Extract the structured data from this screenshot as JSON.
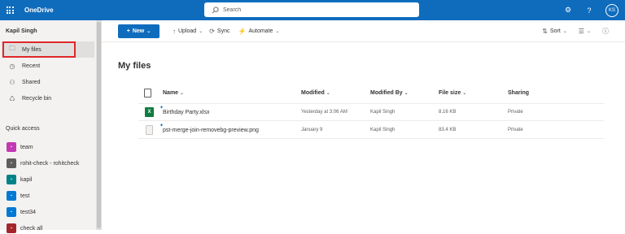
{
  "app": {
    "title": "OneDrive"
  },
  "search": {
    "placeholder": "Search"
  },
  "header": {
    "avatar_initials": "KS"
  },
  "sidebar": {
    "user_name": "Kapil Singh",
    "items": [
      {
        "label": "My files",
        "icon": "folder-icon"
      },
      {
        "label": "Recent",
        "icon": "clock-icon"
      },
      {
        "label": "Shared",
        "icon": "people-icon"
      },
      {
        "label": "Recycle bin",
        "icon": "recycle-bin-icon"
      }
    ],
    "quick_access_title": "Quick access",
    "quick_access": [
      {
        "label": "team",
        "color": "#c239b3"
      },
      {
        "label": "rohit-check - rohitcheck",
        "color": "#605e5c"
      },
      {
        "label": "kapil",
        "color": "#038387"
      },
      {
        "label": "test",
        "color": "#0078d4"
      },
      {
        "label": "test34",
        "color": "#0078d4"
      },
      {
        "label": "check all",
        "color": "#a4262c"
      }
    ]
  },
  "commands": {
    "new": "New",
    "upload": "Upload",
    "sync": "Sync",
    "automate": "Automate",
    "sort": "Sort"
  },
  "main": {
    "title": "My files",
    "columns": [
      "Name",
      "Modified",
      "Modified By",
      "File size",
      "Sharing"
    ],
    "rows": [
      {
        "name": "Birthday Party.xlsx",
        "modified": "Yesterday at 3:06 AM",
        "modified_by": "Kapil Singh",
        "size": "8.16 KB",
        "sharing": "Private"
      },
      {
        "name": "pst-merge-join-removebg-preview.png",
        "modified": "January 9",
        "modified_by": "Kapil Singh",
        "size": "83.4 KB",
        "sharing": "Private"
      }
    ]
  },
  "colors": {
    "brand": "#0f6cbd",
    "highlight": "#e0272a"
  }
}
